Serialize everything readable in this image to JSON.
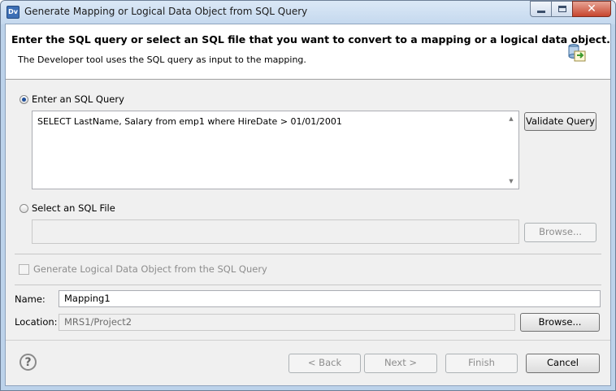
{
  "window": {
    "title": "Generate Mapping or Logical Data Object from SQL Query",
    "app_icon_text": "Dv"
  },
  "header": {
    "title": "Enter the SQL query or select an SQL file that you want to convert to a mapping or a logical data object.",
    "description": "The Developer tool uses the SQL query as input to the mapping."
  },
  "sql_query": {
    "radio_label": "Enter an SQL Query",
    "selected": true,
    "value": "SELECT LastName, Salary from emp1 where HireDate > 01/01/2001",
    "validate_label": "Validate Query"
  },
  "sql_file": {
    "radio_label": "Select an SQL File",
    "selected": false,
    "value": "",
    "browse_label": "Browse..."
  },
  "generate_ldo": {
    "label": "Generate Logical Data Object from the SQL Query",
    "checked": false,
    "enabled": false
  },
  "name_field": {
    "label": "Name:",
    "value": "Mapping1"
  },
  "location_field": {
    "label": "Location:",
    "value": "MRS1/Project2",
    "browse_label": "Browse..."
  },
  "footer": {
    "back_label": "< Back",
    "next_label": "Next >",
    "finish_label": "Finish",
    "cancel_label": "Cancel"
  }
}
